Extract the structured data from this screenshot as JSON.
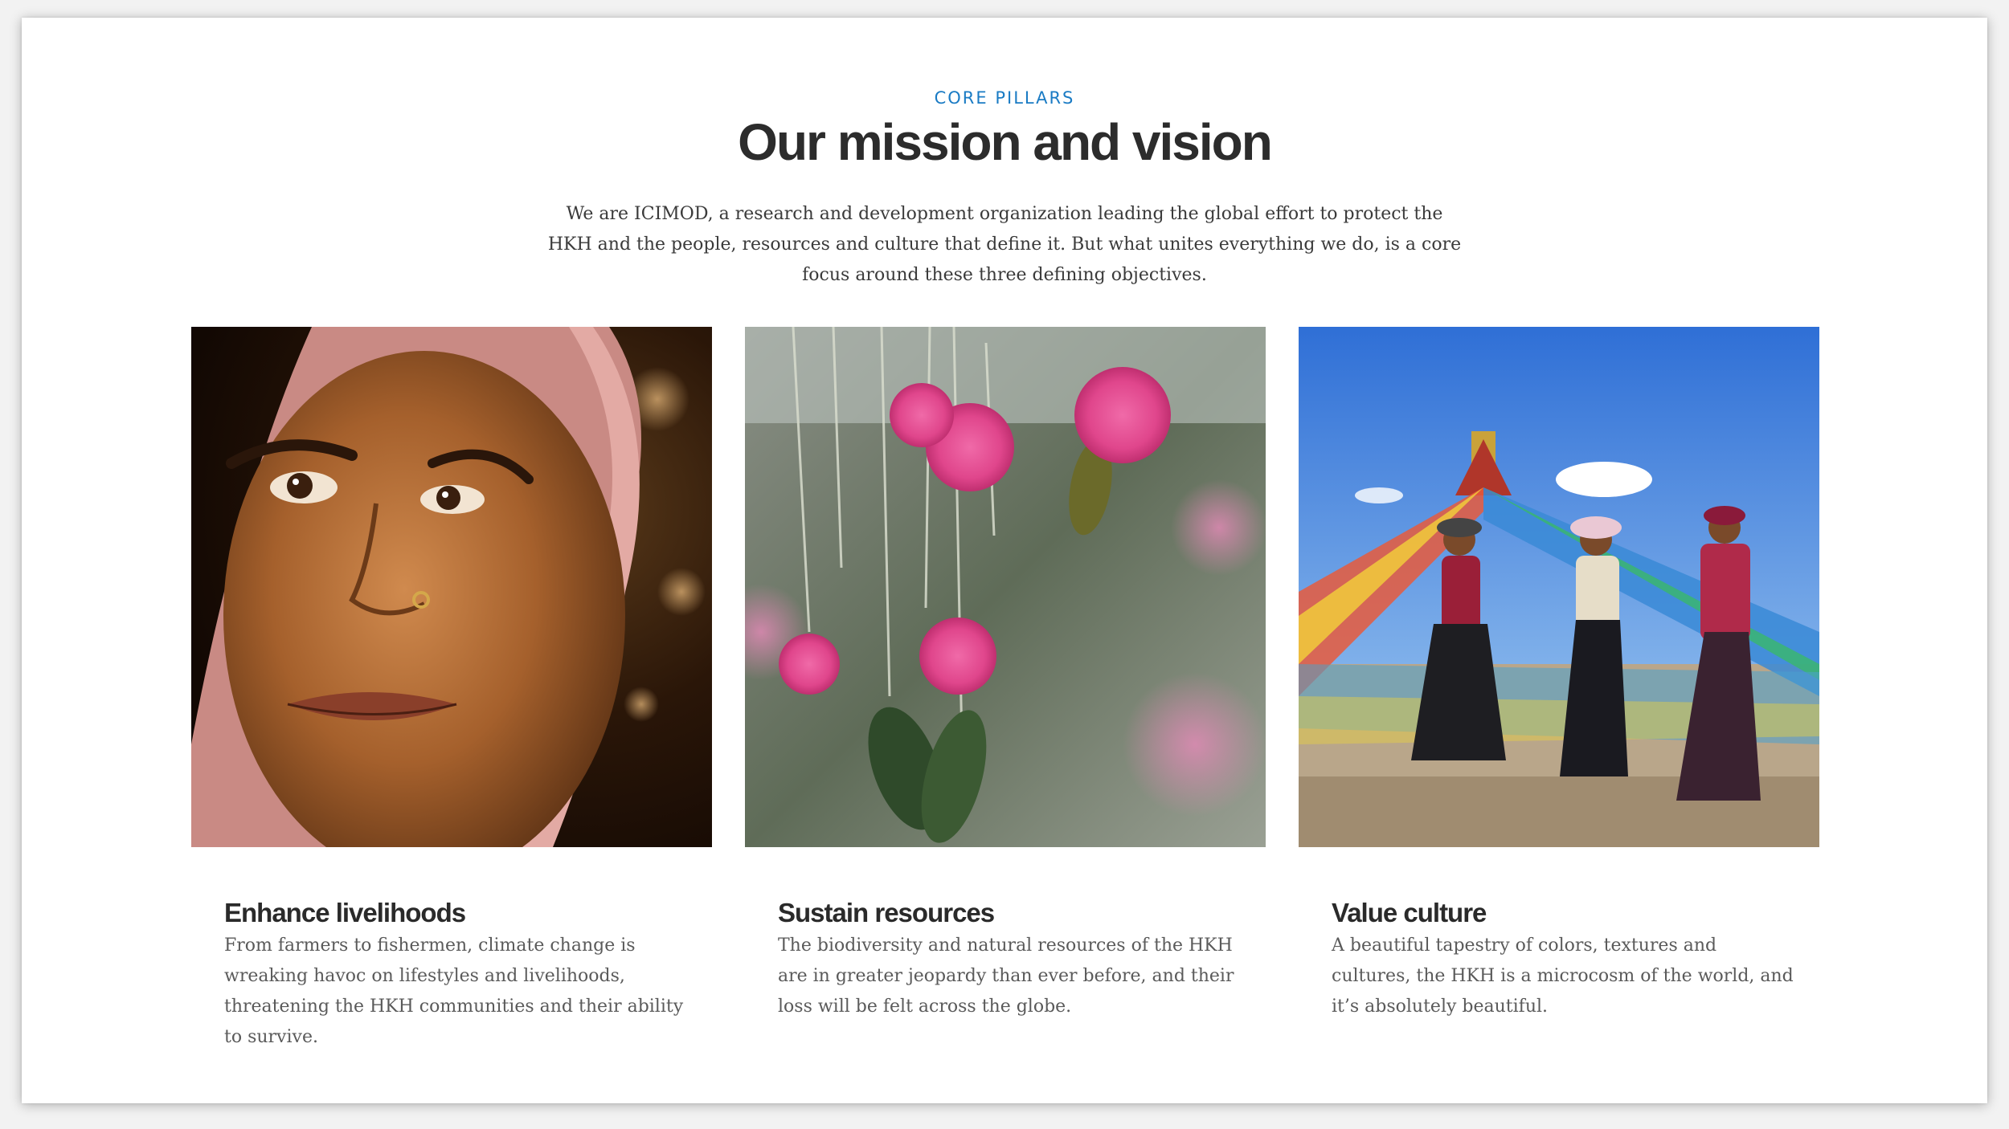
{
  "section": {
    "eyebrow": "CORE PILLARS",
    "title": "Our mission and vision",
    "intro": "We are ICIMOD, a research and development organization leading the global effort to protect the HKH and the people, resources and culture that define it. But what unites everything we do, is a core focus around these three defining objectives."
  },
  "pillars": [
    {
      "title": "Enhance livelihoods",
      "text": "From farmers to fishermen, climate change is wreaking havoc on lifestyles and livelihoods, threatening the HKH communities and their ability to survive.",
      "image": "woman-portrait-photo"
    },
    {
      "title": "Sustain resources",
      "text": "The biodiversity and natural resources of the HKH are in greater jeopardy than ever before, and their loss will be felt across the globe.",
      "image": "rhododendron-flowers-photo"
    },
    {
      "title": "Value culture",
      "text": "A beautiful tapestry of colors, textures and cultures, the HKH is a microcosm of the world, and  it’s absolutely beautiful.",
      "image": "prayer-flags-pilgrims-photo"
    }
  ],
  "colors": {
    "accent": "#1a7bc4",
    "heading": "#2c2c2c",
    "body": "#5a5a5a"
  }
}
